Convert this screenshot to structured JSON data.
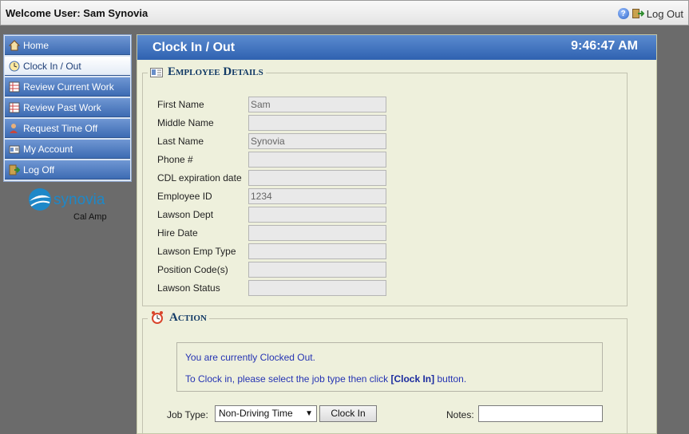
{
  "topbar": {
    "welcome": "Welcome User: Sam Synovia",
    "logout_label": "Log Out"
  },
  "sidebar": {
    "items": [
      {
        "label": "Home",
        "icon": "home-icon"
      },
      {
        "label": "Clock In / Out",
        "icon": "clock-in-out-icon",
        "active": true
      },
      {
        "label": "Review Current Work",
        "icon": "grid-icon"
      },
      {
        "label": "Review Past Work",
        "icon": "grid-icon"
      },
      {
        "label": "Request Time Off",
        "icon": "person-icon"
      },
      {
        "label": "My Account",
        "icon": "id-card-icon"
      },
      {
        "label": "Log Off",
        "icon": "logoff-icon"
      }
    ]
  },
  "logo": {
    "brand": "synovia",
    "tagline": "Cal Amp"
  },
  "main": {
    "title": "Clock In / Out",
    "time": "9:46:47 AM"
  },
  "employee_details": {
    "legend": "Employee Details",
    "fields": [
      {
        "label": "First Name",
        "value": "Sam"
      },
      {
        "label": "Middle Name",
        "value": ""
      },
      {
        "label": "Last Name",
        "value": "Synovia"
      },
      {
        "label": "Phone #",
        "value": ""
      },
      {
        "label": "CDL expiration date",
        "value": ""
      },
      {
        "label": "Employee ID",
        "value": "1234"
      },
      {
        "label": "Lawson Dept",
        "value": ""
      },
      {
        "label": "Hire Date",
        "value": ""
      },
      {
        "label": "Lawson Emp Type",
        "value": ""
      },
      {
        "label": "Position Code(s)",
        "value": ""
      },
      {
        "label": "Lawson Status",
        "value": ""
      }
    ]
  },
  "action": {
    "legend": "Action",
    "status_text": "You are currently Clocked Out.",
    "instruction_prefix": "To Clock in, please select the job type then click ",
    "instruction_bold": "[Clock In]",
    "instruction_suffix": " button.",
    "job_type_label": "Job Type:",
    "job_type_value": "Non-Driving Time",
    "clock_in_button": "Clock In",
    "notes_label": "Notes:",
    "notes_value": ""
  },
  "colors": {
    "header_blue": "#2f62b0",
    "panel_bg": "#eef0dc",
    "legend_text": "#123a66",
    "info_text": "#2533b3"
  }
}
